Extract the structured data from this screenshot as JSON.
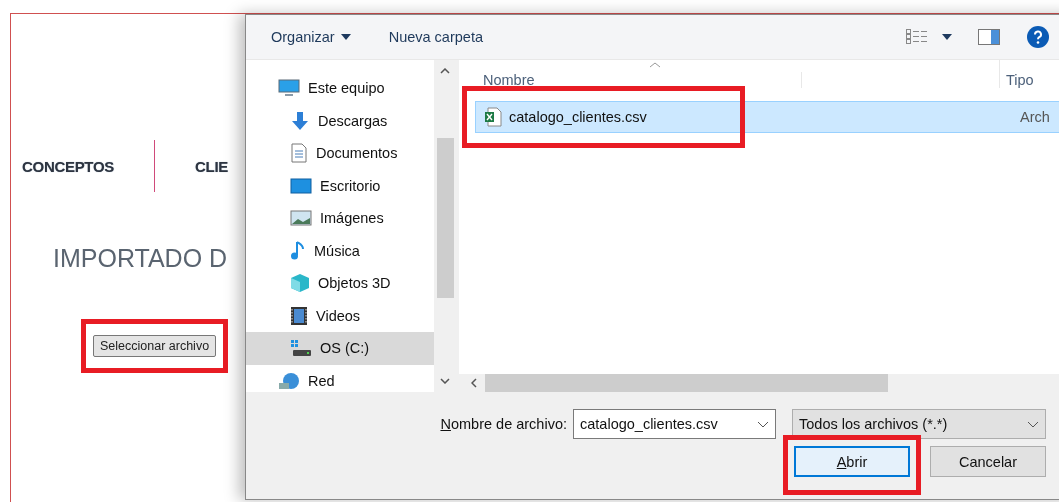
{
  "page": {
    "tabs": [
      {
        "label": "CONCEPTOS"
      },
      {
        "label": "CLIE"
      }
    ],
    "heading": "IMPORTADO D",
    "file_button": {
      "label": "Seleccionar archivo",
      "highlighted": true
    }
  },
  "dialog": {
    "toolbar": {
      "organize": "Organizar",
      "new_folder": "Nueva carpeta"
    },
    "nav": [
      {
        "label": "Este equipo",
        "kind": "pc",
        "selected": false,
        "children": [
          {
            "label": "Descargas",
            "kind": "downloads",
            "selected": false
          },
          {
            "label": "Documentos",
            "kind": "documents",
            "selected": false
          },
          {
            "label": "Escritorio",
            "kind": "desktop",
            "selected": false
          },
          {
            "label": "Imágenes",
            "kind": "pictures",
            "selected": false
          },
          {
            "label": "Música",
            "kind": "music",
            "selected": false
          },
          {
            "label": "Objetos 3D",
            "kind": "objects",
            "selected": false
          },
          {
            "label": "Videos",
            "kind": "videos",
            "selected": false
          },
          {
            "label": "OS (C:)",
            "kind": "drive",
            "selected": true
          }
        ]
      },
      {
        "label": "Red",
        "kind": "network",
        "selected": false
      }
    ],
    "columns": [
      "Nombre",
      "Tipo"
    ],
    "files": [
      {
        "name": "catalogo_clientes.csv",
        "type": "Arch",
        "selected": true,
        "highlighted": true
      }
    ],
    "filename_label": "Nombre de archivo:",
    "filename_value": "catalogo_clientes.csv",
    "filter": "Todos los archivos (*.*)",
    "buttons": [
      {
        "label": "Abrir",
        "kind": "primary",
        "highlighted": true
      },
      {
        "label": "Cancelar",
        "kind": "secondary",
        "highlighted": false
      }
    ]
  }
}
